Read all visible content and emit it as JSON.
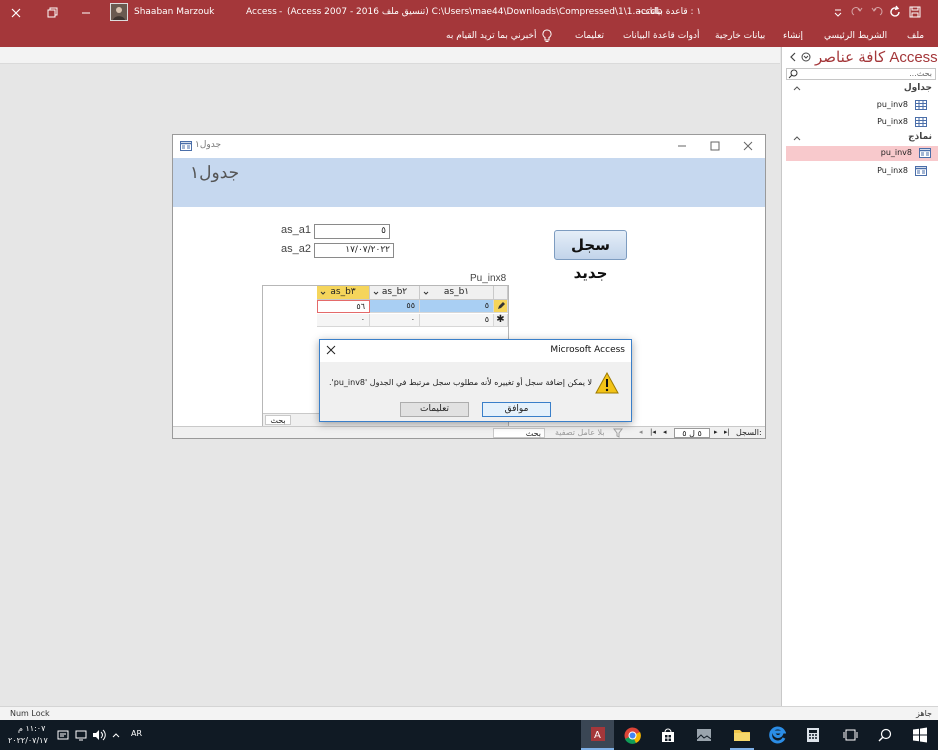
{
  "titlebar": {
    "user_name": "Shaaban Marzouk",
    "app_name": "Access",
    "separator": "-",
    "file_info": "(Access 2007 - 2016 تنسيق ملف) C:\\Users\\mae44\\Downloads\\Compressed\\1\\1.accdb",
    "db_label": "١ : قاعدة بيانات-",
    "background_color": "#a4373a"
  },
  "ribbon": {
    "tabs": [
      "ملف",
      "الشريط الرئيسي",
      "إنشاء",
      "بيانات خارجية",
      "أدوات قاعدة البيانات",
      "تعليمات"
    ],
    "tell_me": "أخبرني بما تريد القيام به"
  },
  "nav_pane": {
    "title": "كافة عناصر Access",
    "search_placeholder": "بحث...",
    "groups": [
      {
        "label": "جداول",
        "items": [
          "pu_inv8",
          "Pu_inx8"
        ]
      },
      {
        "label": "نماذج",
        "items": [
          "pu_inv8",
          "Pu_inx8"
        ]
      }
    ],
    "selected_color": "#f8c9cc"
  },
  "form": {
    "tab_title": "جدول١",
    "header_title": "جدول١",
    "fields": [
      {
        "label": "as_a1",
        "value": "٥"
      },
      {
        "label": "as_a2",
        "value": "١٧/٠٧/٢٠٢٢"
      }
    ],
    "new_record_button": "سجل جديد",
    "subform_label": "Pu_inx8",
    "columns": [
      "as_b١",
      "as_b٢",
      "as_b٣"
    ],
    "rows": [
      [
        "٥",
        "٥٥",
        "٥٦"
      ],
      [
        "٥",
        "٠",
        "٠"
      ]
    ],
    "subform_search": "بحث",
    "record_nav": {
      "label": "السجل:",
      "position": "٥ ل ٥",
      "filter": "بلا عامل تصفية",
      "search": "بحث"
    }
  },
  "dialog": {
    "title": "Microsoft Access",
    "message": "لا يمكن إضافة سجل أو تغييره لأنه مطلوب سجل مرتبط في الجدول 'pu_inv8'.",
    "ok_button": "موافق",
    "help_button": "تعليمات"
  },
  "statusbar": {
    "left_text": "Num Lock",
    "right_text": "جاهز"
  },
  "taskbar": {
    "time": "١١:٠٧ م",
    "date": "٢٠٢٢/٠٧/١٧",
    "language": "AR"
  }
}
